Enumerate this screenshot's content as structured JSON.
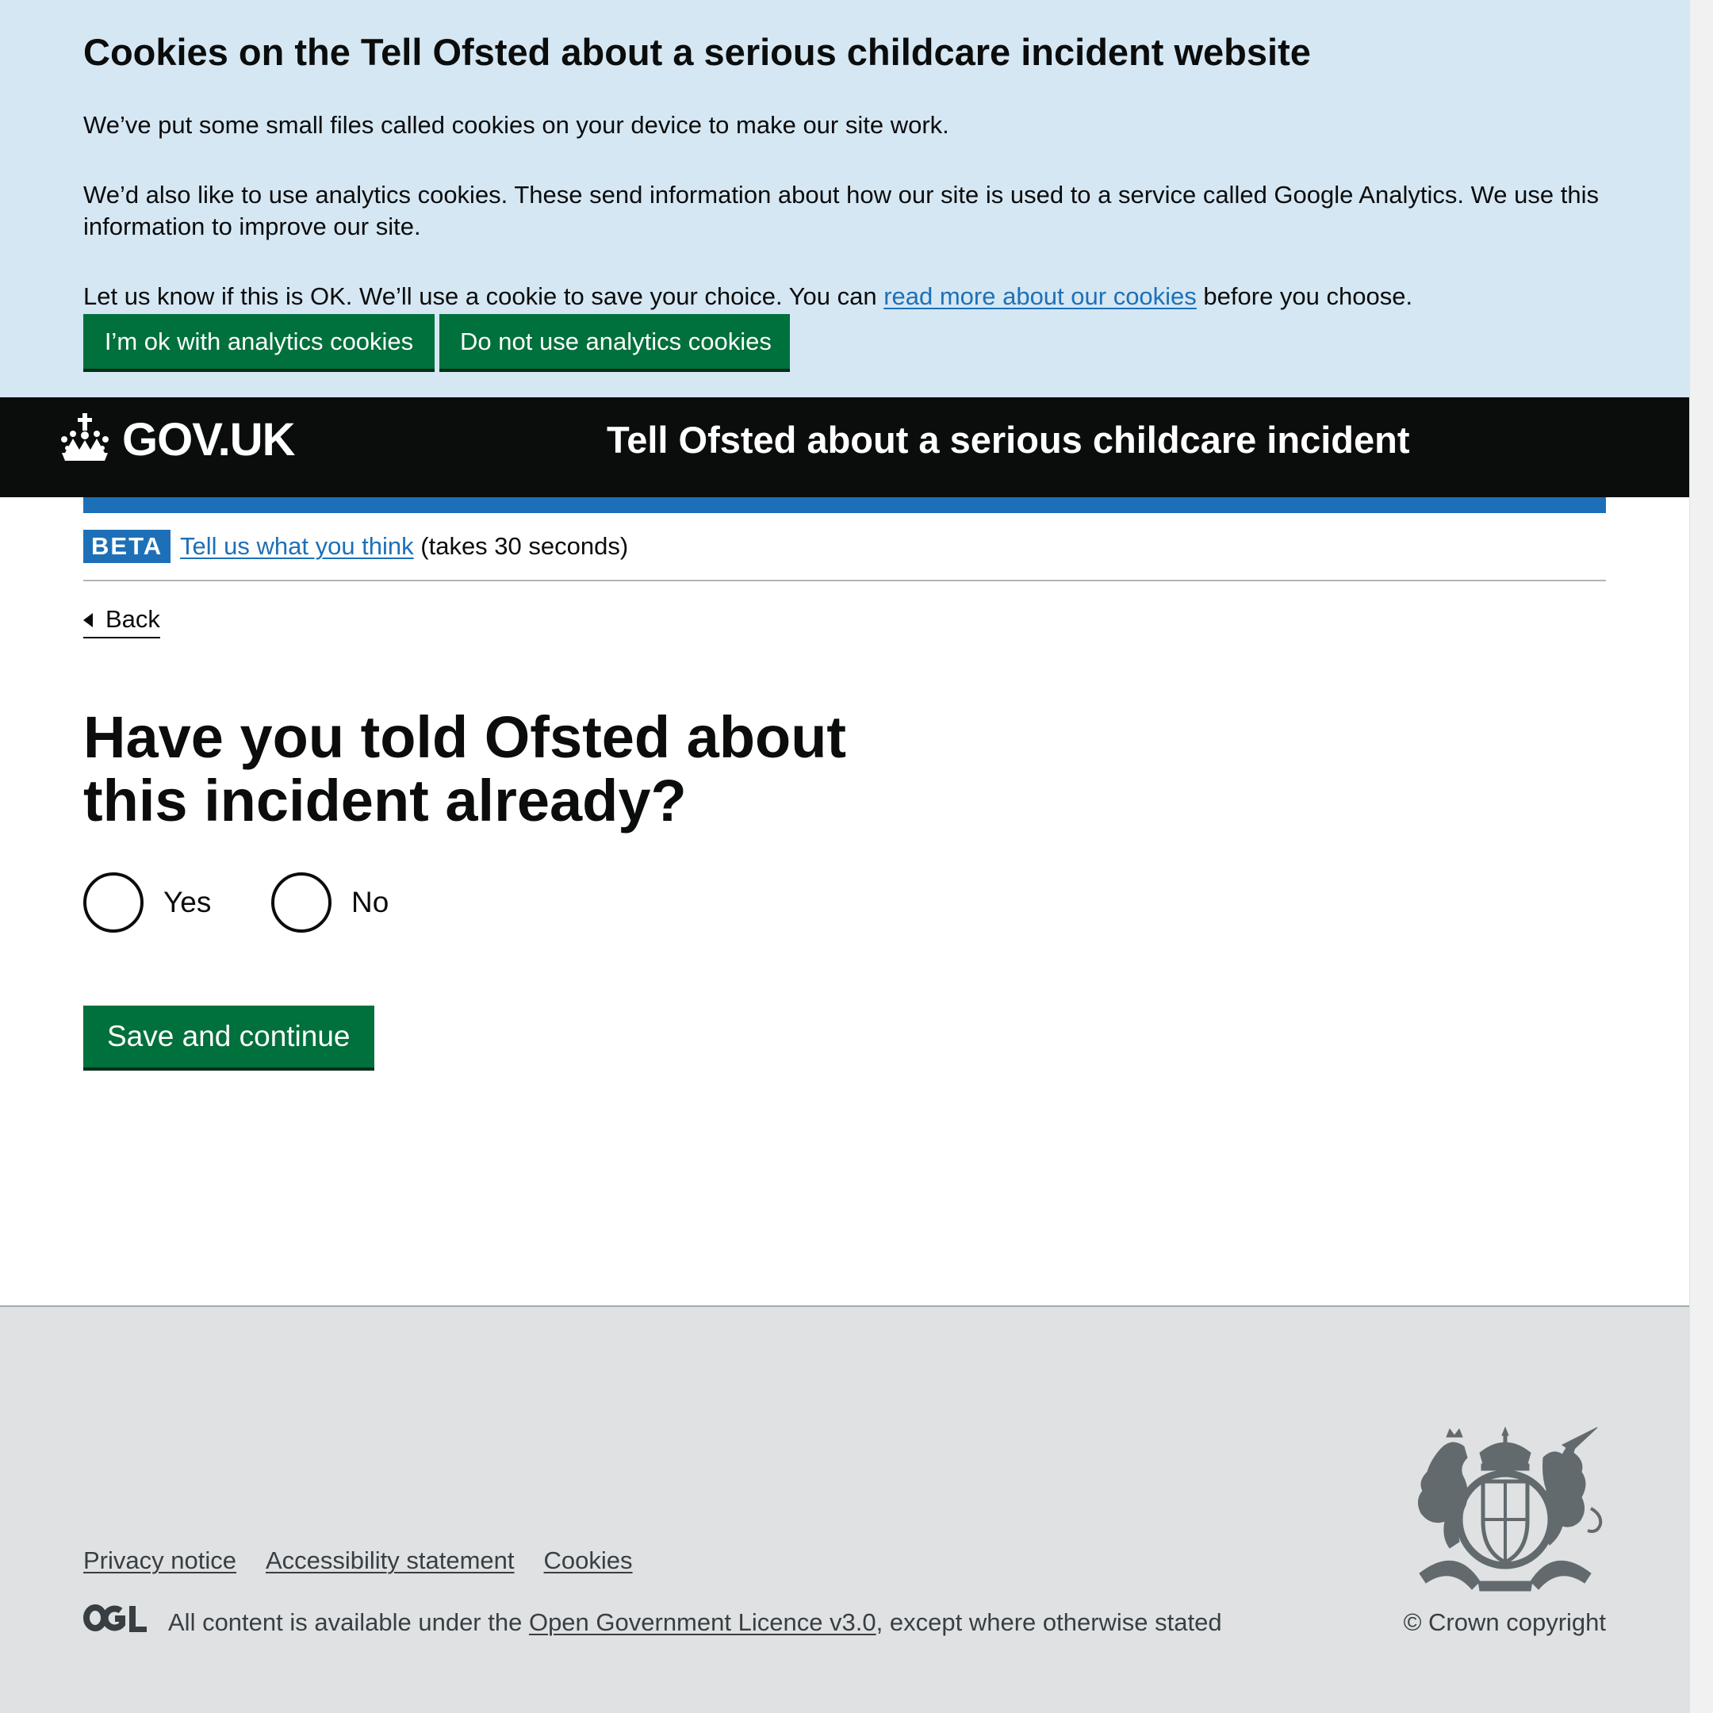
{
  "cookie_banner": {
    "heading": "Cookies on the Tell Ofsted about a serious childcare incident website",
    "paragraph1": "We’ve put some small files called cookies on your device to make our site work.",
    "paragraph2": "We’d also like to use analytics cookies. These send information about how our site is used to a service called Google Analytics. We use this information to improve our site.",
    "paragraph3_before": "Let us know if this is OK. We’ll use a cookie to save your choice. You can ",
    "paragraph3_link": "read more about our cookies",
    "paragraph3_after": " before you choose.",
    "accept_label": "I’m ok with analytics cookies",
    "reject_label": "Do not use analytics cookies"
  },
  "header": {
    "logo_text": "GOV.UK",
    "service_name": "Tell Ofsted about a serious childcare incident"
  },
  "phase_banner": {
    "tag": "BETA",
    "feedback_link": "Tell us what you think",
    "feedback_suffix": " (takes 30 seconds)"
  },
  "back_link": "Back",
  "question": {
    "heading": "Have you told Ofsted about this incident already?",
    "options": [
      "Yes",
      "No"
    ]
  },
  "save_button": "Save and continue",
  "footer": {
    "links": [
      "Privacy notice",
      "Accessibility statement",
      "Cookies"
    ],
    "ogl_logo": "OGL",
    "licence_before": "All content is available under the ",
    "licence_link": "Open Government Licence v3.0",
    "licence_after": ", except where otherwise stated",
    "copyright": "© Crown copyright"
  },
  "colors": {
    "cookie_banner_bg": "#d5e7f3",
    "header_bg": "#0b0c0c",
    "brand_blue": "#1d70b8",
    "button_green": "#00703c",
    "footer_bg": "#dfe1e3"
  }
}
